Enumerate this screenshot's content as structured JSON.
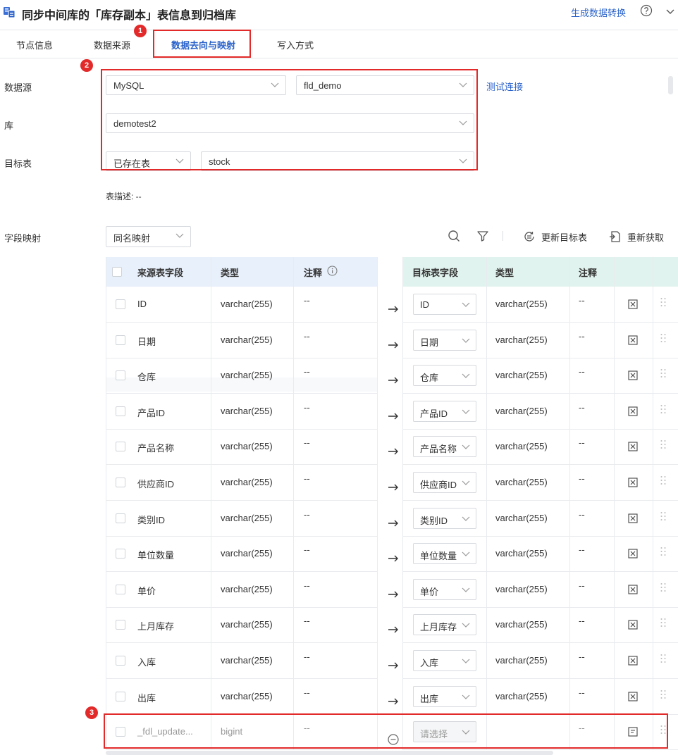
{
  "header": {
    "title": "同步中间库的「库存副本」表信息到归档库",
    "generate_link": "生成数据转换"
  },
  "tabs": [
    "节点信息",
    "数据来源",
    "数据去向与映射",
    "写入方式"
  ],
  "active_tab": 2,
  "badges": [
    "1",
    "2",
    "3"
  ],
  "form": {
    "datasource_label": "数据源",
    "datasource_type": "MySQL",
    "datasource_conn": "fld_demo",
    "test_link": "测试连接",
    "db_label": "库",
    "db_value": "demotest2",
    "target_label": "目标表",
    "target_mode": "已存在表",
    "target_table": "stock",
    "desc_label": "表描述: --",
    "mapping_label": "字段映射",
    "mapping_mode": "同名映射"
  },
  "toolbar": {
    "update_target": "更新目标表",
    "refetch": "重新获取"
  },
  "table": {
    "source_headers": [
      "来源表字段",
      "类型",
      "注释"
    ],
    "target_headers": [
      "目标表字段",
      "类型",
      "注释"
    ],
    "rows": [
      {
        "src": "ID",
        "type": "varchar(255)",
        "note": "--",
        "tgt": "ID",
        "tgt_type": "varchar(255)",
        "tgt_note": "--"
      },
      {
        "src": "日期",
        "type": "varchar(255)",
        "note": "--",
        "tgt": "日期",
        "tgt_type": "varchar(255)",
        "tgt_note": "--"
      },
      {
        "src": "仓库",
        "type": "varchar(255)",
        "note": "--",
        "tgt": "仓库",
        "tgt_type": "varchar(255)",
        "tgt_note": "--"
      },
      {
        "src": "产品ID",
        "type": "varchar(255)",
        "note": "--",
        "tgt": "产品ID",
        "tgt_type": "varchar(255)",
        "tgt_note": "--"
      },
      {
        "src": "产品名称",
        "type": "varchar(255)",
        "note": "--",
        "tgt": "产品名称",
        "tgt_type": "varchar(255)",
        "tgt_note": "--"
      },
      {
        "src": "供应商ID",
        "type": "varchar(255)",
        "note": "--",
        "tgt": "供应商ID",
        "tgt_type": "varchar(255)",
        "tgt_note": "--"
      },
      {
        "src": "类别ID",
        "type": "varchar(255)",
        "note": "--",
        "tgt": "类别ID",
        "tgt_type": "varchar(255)",
        "tgt_note": "--"
      },
      {
        "src": "单位数量",
        "type": "varchar(255)",
        "note": "--",
        "tgt": "单位数量",
        "tgt_type": "varchar(255)",
        "tgt_note": "--"
      },
      {
        "src": "单价",
        "type": "varchar(255)",
        "note": "--",
        "tgt": "单价",
        "tgt_type": "varchar(255)",
        "tgt_note": "--"
      },
      {
        "src": "上月库存",
        "type": "varchar(255)",
        "note": "--",
        "tgt": "上月库存",
        "tgt_type": "varchar(255)",
        "tgt_note": "--"
      },
      {
        "src": "入库",
        "type": "varchar(255)",
        "note": "--",
        "tgt": "入库",
        "tgt_type": "varchar(255)",
        "tgt_note": "--"
      },
      {
        "src": "出库",
        "type": "varchar(255)",
        "note": "--",
        "tgt": "出库",
        "tgt_type": "varchar(255)",
        "tgt_note": "--"
      },
      {
        "src": "_fdl_update...",
        "type": "bigint",
        "note": "--",
        "tgt": "请选择",
        "tgt_type": "",
        "tgt_note": "--",
        "disabled": true
      }
    ]
  },
  "colors": {
    "accent": "#2a62c9",
    "highlight": "#e32a2a"
  }
}
